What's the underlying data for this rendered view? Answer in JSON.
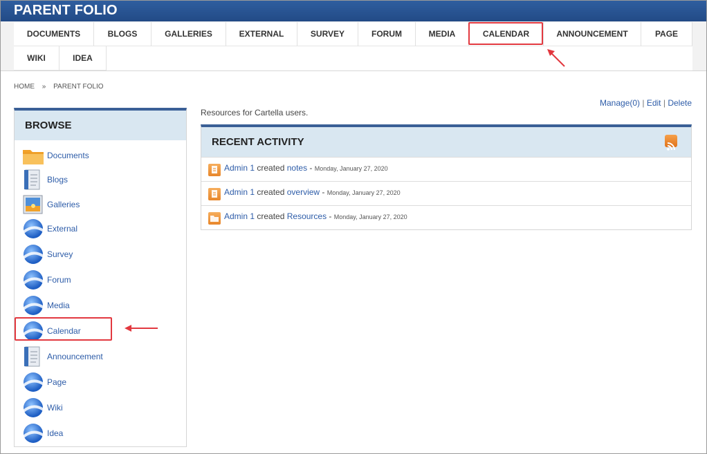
{
  "app_title": "PARENT FOLIO",
  "nav": {
    "items": [
      "DOCUMENTS",
      "BLOGS",
      "GALLERIES",
      "EXTERNAL",
      "SURVEY",
      "FORUM",
      "MEDIA",
      "CALENDAR",
      "ANNOUNCEMENT",
      "PAGE",
      "WIKI",
      "IDEA"
    ]
  },
  "breadcrumb": {
    "home": "HOME",
    "sep": "»",
    "current": "PARENT FOLIO"
  },
  "toplinks": {
    "manage": "Manage(0)",
    "sep": " | ",
    "edit": "Edit",
    "delete": "Delete"
  },
  "browse": {
    "title": "BROWSE",
    "items": [
      "Documents",
      "Blogs",
      "Galleries",
      "External",
      "Survey",
      "Forum",
      "Media",
      "Calendar",
      "Announcement",
      "Page",
      "Wiki",
      "Idea"
    ]
  },
  "description": "Resources for Cartella users.",
  "recent": {
    "title": "RECENT ACTIVITY",
    "rows": [
      {
        "user": "Admin 1",
        "action": " created ",
        "item": "notes",
        "dash": " - ",
        "date": "Monday, January 27, 2020"
      },
      {
        "user": "Admin 1",
        "action": " created ",
        "item": "overview",
        "dash": " - ",
        "date": "Monday, January 27, 2020"
      },
      {
        "user": "Admin 1",
        "action": " created ",
        "item": "Resources",
        "dash": " - ",
        "date": "Monday, January 27, 2020"
      }
    ]
  },
  "colors": {
    "header_blue": "#2f5e9f",
    "link_blue": "#2d5ca8",
    "highlight_red": "#e2383f",
    "panel_head": "#d9e7f1"
  },
  "icons": [
    "folder-icon",
    "document-icon",
    "gallery-icon",
    "globe-icon",
    "rss-icon"
  ]
}
